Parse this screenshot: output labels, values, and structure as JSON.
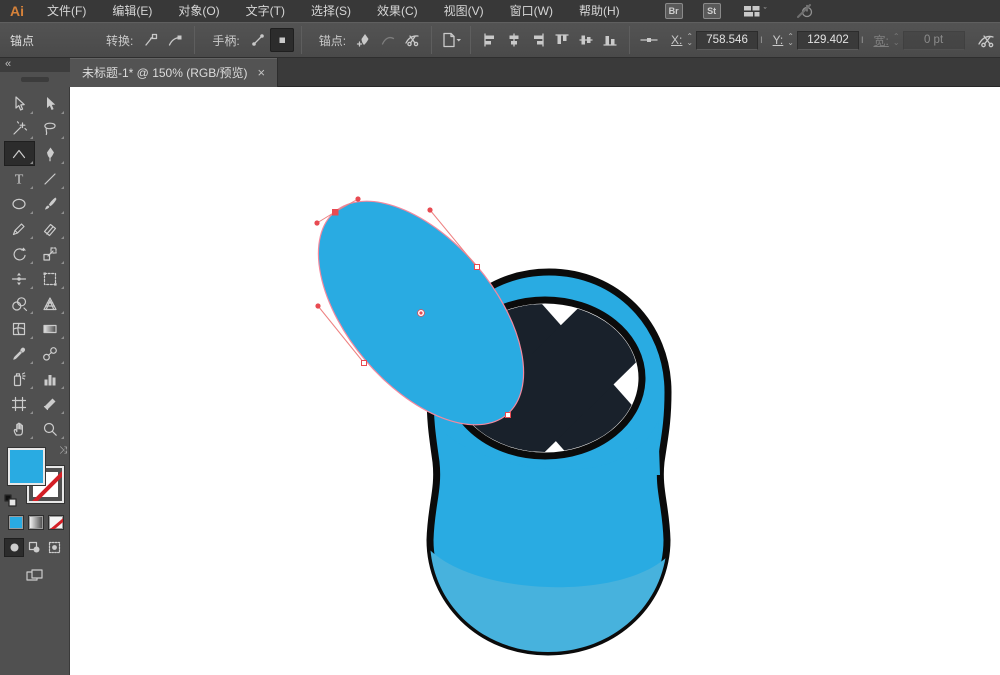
{
  "app": {
    "logo_text": "Ai"
  },
  "menubar": {
    "items": [
      "文件(F)",
      "编辑(E)",
      "对象(O)",
      "文字(T)",
      "选择(S)",
      "效果(C)",
      "视图(V)",
      "窗口(W)",
      "帮助(H)"
    ],
    "bridge_label": "Br",
    "stock_label": "St"
  },
  "optionsbar": {
    "context_label": "锚点",
    "convert_label": "转换:",
    "handles_label": "手柄:",
    "anchors_label": "锚点:",
    "x_label": "X:",
    "x_value": "758.546",
    "y_label": "Y:",
    "y_value": "129.402",
    "width_label": "宽:",
    "width_value": "0 pt"
  },
  "tabbar": {
    "title": "未标题-1* @ 150% (RGB/预览)",
    "close_glyph": "×"
  },
  "toolpanel": {
    "collapse_glyph": "«",
    "tools": [
      "selection",
      "direct-selection",
      "magic-wand",
      "lasso",
      "anchor-point",
      "pen",
      "type",
      "line-segment",
      "ellipse",
      "paintbrush",
      "pencil",
      "eraser",
      "rotate",
      "scale",
      "width",
      "free-transform",
      "shape-builder",
      "perspective-grid",
      "mesh",
      "gradient",
      "eyedropper",
      "blend",
      "symbol-sprayer",
      "column-graph",
      "artboard",
      "slice",
      "hand",
      "zoom"
    ],
    "selected_tool": "anchor-point",
    "fill_color": "#29abe2",
    "stroke_style": "none"
  },
  "icons": {
    "stepper_up": "⌃",
    "stepper_down": "⌄",
    "chevron_down": "ˇ",
    "swap_glyph": "⤨"
  },
  "document": {
    "zoom_level": "150%",
    "color_mode": "RGB/预览",
    "name": "未标题-1"
  },
  "artwork": {
    "colors": {
      "blue": "#29abe2",
      "blue_shade": "#47b2dd",
      "dark_navy": "#19212b",
      "outline": "#0b0b0b",
      "selection_path": "#f2899f",
      "selection_line": "#ee8181",
      "selection_dot": "#e84a51"
    }
  }
}
